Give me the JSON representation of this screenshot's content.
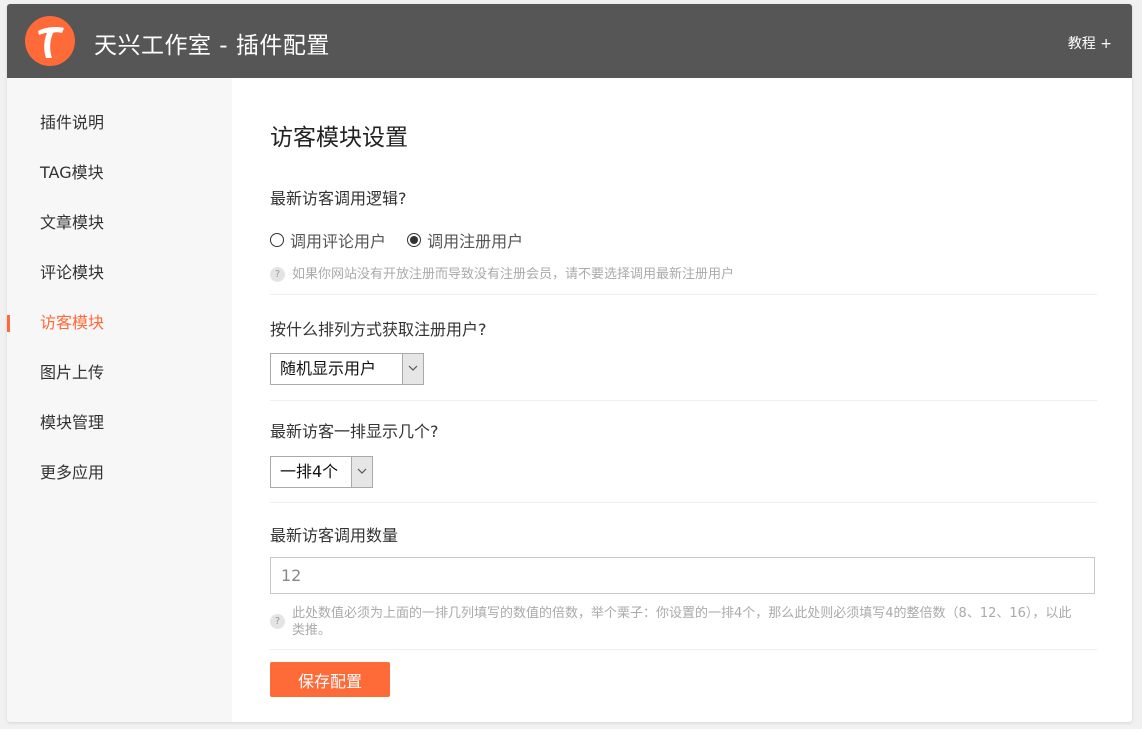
{
  "header": {
    "title": "天兴工作室 - 插件配置",
    "tutorial_link": "教程 +",
    "logo_icon": "tianxing-logo-icon",
    "background_color": "#565656",
    "accent_color": "#ff6a39"
  },
  "sidebar": {
    "items": [
      {
        "label": "插件说明",
        "active": false
      },
      {
        "label": "TAG模块",
        "active": false
      },
      {
        "label": "文章模块",
        "active": false
      },
      {
        "label": "评论模块",
        "active": false
      },
      {
        "label": "访客模块",
        "active": true
      },
      {
        "label": "图片上传",
        "active": false
      },
      {
        "label": "模块管理",
        "active": false
      },
      {
        "label": "更多应用",
        "active": false
      }
    ]
  },
  "main": {
    "title": "访客模块设置",
    "call_logic": {
      "label": "最新访客调用逻辑?",
      "options": [
        {
          "label": "调用评论用户",
          "checked": false
        },
        {
          "label": "调用注册用户",
          "checked": true
        }
      ],
      "hint": "如果你网站没有开放注册而导致没有注册会员，请不要选择调用最新注册用户"
    },
    "sort_order": {
      "label": "按什么排列方式获取注册用户?",
      "selected": "随机显示用户"
    },
    "per_row": {
      "label": "最新访客一排显示几个?",
      "selected": "一排4个"
    },
    "count": {
      "label": "最新访客调用数量",
      "value": "12",
      "hint": "此处数值必须为上面的一排几列填写的数值的倍数，举个栗子：你设置的一排4个，那么此处则必须填写4的整倍数（8、12、16），以此类推。"
    },
    "save_label": "保存配置",
    "hint_icon": "question-mark-icon"
  }
}
